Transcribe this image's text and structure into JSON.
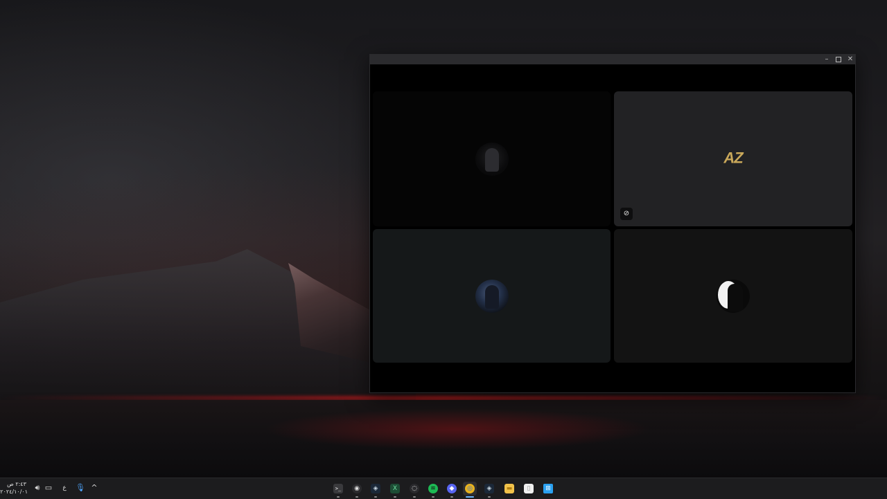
{
  "window": {
    "controls": {
      "minimize_icon": "minimize-icon",
      "maximize_icon": "maximize-icon",
      "close_icon": "close-icon"
    },
    "tiles": [
      {
        "kind": "avatar",
        "icon": "dark-knight-avatar"
      },
      {
        "kind": "logo",
        "logo_main": "AZ",
        "status_icon": "deafened-headset-icon"
      },
      {
        "kind": "avatar",
        "icon": "blue-warrior-avatar"
      },
      {
        "kind": "avatar",
        "icon": "moon-silhouette-avatar"
      }
    ]
  },
  "taskbar": {
    "clock": {
      "time": "٢:٤٣ ص",
      "date": "٢٠٢٤/١٠/٠١"
    },
    "tray": {
      "language": "ع",
      "volume_icon": "speaker-icon",
      "display_icon": "monitor-icon",
      "mic_icon": "microphone-icon",
      "overflow_icon": "chevron-up-icon"
    },
    "apps": [
      {
        "name": "terminal",
        "glyph": ">_"
      },
      {
        "name": "obs",
        "glyph": "◉"
      },
      {
        "name": "steam",
        "glyph": "◈"
      },
      {
        "name": "excel",
        "glyph": "X"
      },
      {
        "name": "app-circle",
        "glyph": "◌"
      },
      {
        "name": "spotify",
        "glyph": "≋"
      },
      {
        "name": "discord",
        "glyph": "◆"
      },
      {
        "name": "chrome",
        "glyph": "◎"
      },
      {
        "name": "steam-2",
        "glyph": "◈"
      },
      {
        "name": "file-explorer",
        "glyph": "▬"
      },
      {
        "name": "notepad",
        "glyph": "▯"
      },
      {
        "name": "start",
        "glyph": "⊞"
      }
    ]
  },
  "colors": {
    "window_bg": "#000000",
    "tile_1": "#050505",
    "tile_2": "#222224",
    "tile_3": "#151819",
    "tile_4": "#131313",
    "accent": "#6cb6ff",
    "logo_gold": "#c9a85a"
  }
}
